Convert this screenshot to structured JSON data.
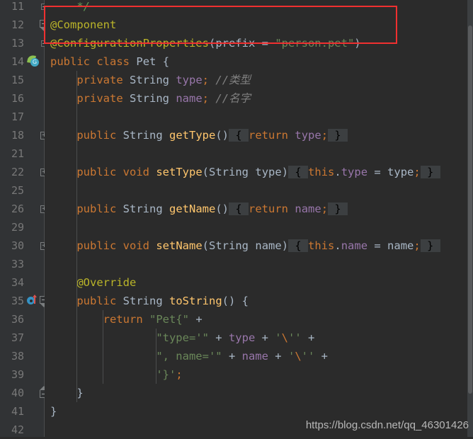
{
  "editor": {
    "theme_name": "darcula",
    "background": "#2b2b2b",
    "gutter_background": "#313335",
    "accent_highlight": "#f03030",
    "watermark": "https://blog.csdn.net/qq_46301426"
  },
  "gutter": {
    "line_numbers": [
      "11",
      "12",
      "13",
      "14",
      "15",
      "16",
      "17",
      "18",
      "21",
      "22",
      "25",
      "26",
      "29",
      "30",
      "33",
      "34",
      "35",
      "36",
      "37",
      "38",
      "39",
      "40",
      "41",
      "42"
    ],
    "icons": [
      {
        "line": "14",
        "name": "spring-bean-icon",
        "glyph": "G"
      },
      {
        "line": "35",
        "name": "override-method-icon",
        "glyph": "↑"
      }
    ],
    "fold_markers": [
      {
        "line": "11",
        "type": "collapse-up"
      },
      {
        "line": "12",
        "type": "collapse-down"
      },
      {
        "line": "13",
        "type": "collapse-up"
      },
      {
        "line": "18",
        "type": "expand"
      },
      {
        "line": "22",
        "type": "expand"
      },
      {
        "line": "26",
        "type": "expand"
      },
      {
        "line": "30",
        "type": "expand"
      },
      {
        "line": "35",
        "type": "collapse-down"
      },
      {
        "line": "40",
        "type": "collapse-up"
      }
    ]
  },
  "code_lines": [
    {
      "num": "11",
      "tokens": [
        {
          "t": "    */",
          "c": "cmtgreen"
        }
      ]
    },
    {
      "num": "12",
      "tokens": [
        {
          "t": "@Component",
          "c": "ann"
        }
      ]
    },
    {
      "num": "13",
      "tokens": [
        {
          "t": "@ConfigurationProperties",
          "c": "ann"
        },
        {
          "t": "(",
          "c": "plain"
        },
        {
          "t": "prefix",
          "c": "param"
        },
        {
          "t": " = ",
          "c": "plain"
        },
        {
          "t": "\"person.pet\"",
          "c": "str"
        },
        {
          "t": ")",
          "c": "plain"
        }
      ]
    },
    {
      "num": "14",
      "tokens": [
        {
          "t": "public",
          "c": "kw"
        },
        {
          "t": " ",
          "c": "plain"
        },
        {
          "t": "class",
          "c": "kw"
        },
        {
          "t": " ",
          "c": "plain"
        },
        {
          "t": "Pet",
          "c": "type"
        },
        {
          "t": " {",
          "c": "plain"
        }
      ]
    },
    {
      "num": "15",
      "tokens": [
        {
          "t": "    ",
          "c": "plain"
        },
        {
          "t": "private",
          "c": "kw"
        },
        {
          "t": " ",
          "c": "plain"
        },
        {
          "t": "String",
          "c": "type"
        },
        {
          "t": " ",
          "c": "plain"
        },
        {
          "t": "type",
          "c": "field"
        },
        {
          "t": ";",
          "c": "kw"
        },
        {
          "t": " ",
          "c": "plain"
        },
        {
          "t": "//类型",
          "c": "cmt"
        }
      ]
    },
    {
      "num": "16",
      "tokens": [
        {
          "t": "    ",
          "c": "plain"
        },
        {
          "t": "private",
          "c": "kw"
        },
        {
          "t": " ",
          "c": "plain"
        },
        {
          "t": "String",
          "c": "type"
        },
        {
          "t": " ",
          "c": "plain"
        },
        {
          "t": "name",
          "c": "field"
        },
        {
          "t": ";",
          "c": "kw"
        },
        {
          "t": " ",
          "c": "plain"
        },
        {
          "t": "//名字",
          "c": "cmt"
        }
      ]
    },
    {
      "num": "17",
      "tokens": []
    },
    {
      "num": "18",
      "tokens": [
        {
          "t": "    ",
          "c": "plain"
        },
        {
          "t": "public",
          "c": "kw"
        },
        {
          "t": " ",
          "c": "plain"
        },
        {
          "t": "String",
          "c": "type"
        },
        {
          "t": " ",
          "c": "plain"
        },
        {
          "t": "getType",
          "c": "method"
        },
        {
          "t": "()",
          "c": "plain"
        },
        {
          "t": " { ",
          "c": "folded"
        },
        {
          "t": "return",
          "c": "kw"
        },
        {
          "t": " ",
          "c": "plain"
        },
        {
          "t": "type",
          "c": "field"
        },
        {
          "t": ";",
          "c": "kw"
        },
        {
          "t": " } ",
          "c": "folded"
        }
      ]
    },
    {
      "num": "21",
      "tokens": []
    },
    {
      "num": "22",
      "tokens": [
        {
          "t": "    ",
          "c": "plain"
        },
        {
          "t": "public",
          "c": "kw"
        },
        {
          "t": " ",
          "c": "plain"
        },
        {
          "t": "void",
          "c": "kw"
        },
        {
          "t": " ",
          "c": "plain"
        },
        {
          "t": "setType",
          "c": "method"
        },
        {
          "t": "(",
          "c": "plain"
        },
        {
          "t": "String",
          "c": "type"
        },
        {
          "t": " ",
          "c": "plain"
        },
        {
          "t": "type",
          "c": "param"
        },
        {
          "t": ")",
          "c": "plain"
        },
        {
          "t": " { ",
          "c": "folded"
        },
        {
          "t": "this",
          "c": "kw"
        },
        {
          "t": ".",
          "c": "plain"
        },
        {
          "t": "type",
          "c": "field"
        },
        {
          "t": " = ",
          "c": "plain"
        },
        {
          "t": "type",
          "c": "param"
        },
        {
          "t": ";",
          "c": "kw"
        },
        {
          "t": " } ",
          "c": "folded"
        }
      ]
    },
    {
      "num": "25",
      "tokens": []
    },
    {
      "num": "26",
      "tokens": [
        {
          "t": "    ",
          "c": "plain"
        },
        {
          "t": "public",
          "c": "kw"
        },
        {
          "t": " ",
          "c": "plain"
        },
        {
          "t": "String",
          "c": "type"
        },
        {
          "t": " ",
          "c": "plain"
        },
        {
          "t": "getName",
          "c": "method"
        },
        {
          "t": "()",
          "c": "plain"
        },
        {
          "t": " { ",
          "c": "folded"
        },
        {
          "t": "return",
          "c": "kw"
        },
        {
          "t": " ",
          "c": "plain"
        },
        {
          "t": "name",
          "c": "field"
        },
        {
          "t": ";",
          "c": "kw"
        },
        {
          "t": " } ",
          "c": "folded"
        }
      ]
    },
    {
      "num": "29",
      "tokens": []
    },
    {
      "num": "30",
      "tokens": [
        {
          "t": "    ",
          "c": "plain"
        },
        {
          "t": "public",
          "c": "kw"
        },
        {
          "t": " ",
          "c": "plain"
        },
        {
          "t": "void",
          "c": "kw"
        },
        {
          "t": " ",
          "c": "plain"
        },
        {
          "t": "setName",
          "c": "method"
        },
        {
          "t": "(",
          "c": "plain"
        },
        {
          "t": "String",
          "c": "type"
        },
        {
          "t": " ",
          "c": "plain"
        },
        {
          "t": "name",
          "c": "param"
        },
        {
          "t": ")",
          "c": "plain"
        },
        {
          "t": " { ",
          "c": "folded"
        },
        {
          "t": "this",
          "c": "kw"
        },
        {
          "t": ".",
          "c": "plain"
        },
        {
          "t": "name",
          "c": "field"
        },
        {
          "t": " = ",
          "c": "plain"
        },
        {
          "t": "name",
          "c": "param"
        },
        {
          "t": ";",
          "c": "kw"
        },
        {
          "t": " } ",
          "c": "folded"
        }
      ]
    },
    {
      "num": "33",
      "tokens": []
    },
    {
      "num": "34",
      "tokens": [
        {
          "t": "    ",
          "c": "plain"
        },
        {
          "t": "@Override",
          "c": "ann"
        }
      ]
    },
    {
      "num": "35",
      "tokens": [
        {
          "t": "    ",
          "c": "plain"
        },
        {
          "t": "public",
          "c": "kw"
        },
        {
          "t": " ",
          "c": "plain"
        },
        {
          "t": "String",
          "c": "type"
        },
        {
          "t": " ",
          "c": "plain"
        },
        {
          "t": "toString",
          "c": "method"
        },
        {
          "t": "() {",
          "c": "plain"
        }
      ]
    },
    {
      "num": "36",
      "tokens": [
        {
          "t": "        ",
          "c": "plain"
        },
        {
          "t": "return",
          "c": "kw"
        },
        {
          "t": " ",
          "c": "plain"
        },
        {
          "t": "\"Pet{\"",
          "c": "str"
        },
        {
          "t": " + ",
          "c": "plain"
        }
      ]
    },
    {
      "num": "37",
      "tokens": [
        {
          "t": "                ",
          "c": "plain"
        },
        {
          "t": "\"type='\"",
          "c": "str"
        },
        {
          "t": " + ",
          "c": "plain"
        },
        {
          "t": "type",
          "c": "field"
        },
        {
          "t": " + ",
          "c": "plain"
        },
        {
          "t": "'",
          "c": "str"
        },
        {
          "t": "\\",
          "c": "esc"
        },
        {
          "t": "''",
          "c": "str"
        },
        {
          "t": " + ",
          "c": "plain"
        }
      ]
    },
    {
      "num": "38",
      "tokens": [
        {
          "t": "                ",
          "c": "plain"
        },
        {
          "t": "\", name='\"",
          "c": "str"
        },
        {
          "t": " + ",
          "c": "plain"
        },
        {
          "t": "name",
          "c": "field"
        },
        {
          "t": " + ",
          "c": "plain"
        },
        {
          "t": "'",
          "c": "str"
        },
        {
          "t": "\\",
          "c": "esc"
        },
        {
          "t": "''",
          "c": "str"
        },
        {
          "t": " + ",
          "c": "plain"
        }
      ]
    },
    {
      "num": "39",
      "tokens": [
        {
          "t": "                ",
          "c": "plain"
        },
        {
          "t": "'}'",
          "c": "str"
        },
        {
          "t": ";",
          "c": "kw"
        }
      ]
    },
    {
      "num": "40",
      "tokens": [
        {
          "t": "    }",
          "c": "plain"
        }
      ]
    },
    {
      "num": "41",
      "tokens": [
        {
          "t": "}",
          "c": "plain"
        }
      ]
    },
    {
      "num": "42",
      "tokens": []
    }
  ],
  "annotation_box": {
    "name": "red-highlight-rectangle",
    "color": "#f03030",
    "covers_lines": [
      "12",
      "13"
    ]
  }
}
